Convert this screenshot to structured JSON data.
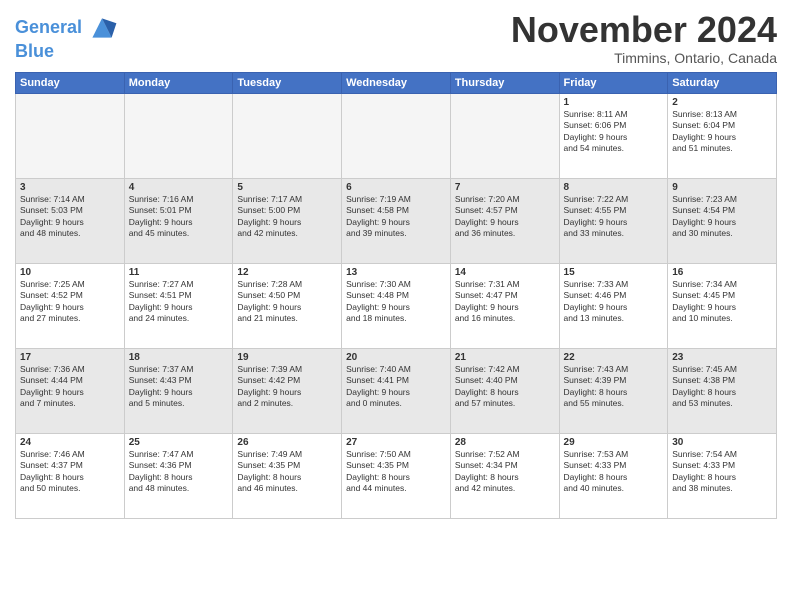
{
  "header": {
    "logo_line1": "General",
    "logo_line2": "Blue",
    "month": "November 2024",
    "location": "Timmins, Ontario, Canada"
  },
  "days_of_week": [
    "Sunday",
    "Monday",
    "Tuesday",
    "Wednesday",
    "Thursday",
    "Friday",
    "Saturday"
  ],
  "weeks": [
    [
      {
        "day": "",
        "info": "",
        "empty": true
      },
      {
        "day": "",
        "info": "",
        "empty": true
      },
      {
        "day": "",
        "info": "",
        "empty": true
      },
      {
        "day": "",
        "info": "",
        "empty": true
      },
      {
        "day": "",
        "info": "",
        "empty": true
      },
      {
        "day": "1",
        "info": "Sunrise: 8:11 AM\nSunset: 6:06 PM\nDaylight: 9 hours\nand 54 minutes."
      },
      {
        "day": "2",
        "info": "Sunrise: 8:13 AM\nSunset: 6:04 PM\nDaylight: 9 hours\nand 51 minutes."
      }
    ],
    [
      {
        "day": "3",
        "info": "Sunrise: 7:14 AM\nSunset: 5:03 PM\nDaylight: 9 hours\nand 48 minutes.",
        "shaded": true
      },
      {
        "day": "4",
        "info": "Sunrise: 7:16 AM\nSunset: 5:01 PM\nDaylight: 9 hours\nand 45 minutes.",
        "shaded": true
      },
      {
        "day": "5",
        "info": "Sunrise: 7:17 AM\nSunset: 5:00 PM\nDaylight: 9 hours\nand 42 minutes.",
        "shaded": true
      },
      {
        "day": "6",
        "info": "Sunrise: 7:19 AM\nSunset: 4:58 PM\nDaylight: 9 hours\nand 39 minutes.",
        "shaded": true
      },
      {
        "day": "7",
        "info": "Sunrise: 7:20 AM\nSunset: 4:57 PM\nDaylight: 9 hours\nand 36 minutes.",
        "shaded": true
      },
      {
        "day": "8",
        "info": "Sunrise: 7:22 AM\nSunset: 4:55 PM\nDaylight: 9 hours\nand 33 minutes.",
        "shaded": true
      },
      {
        "day": "9",
        "info": "Sunrise: 7:23 AM\nSunset: 4:54 PM\nDaylight: 9 hours\nand 30 minutes.",
        "shaded": true
      }
    ],
    [
      {
        "day": "10",
        "info": "Sunrise: 7:25 AM\nSunset: 4:52 PM\nDaylight: 9 hours\nand 27 minutes."
      },
      {
        "day": "11",
        "info": "Sunrise: 7:27 AM\nSunset: 4:51 PM\nDaylight: 9 hours\nand 24 minutes."
      },
      {
        "day": "12",
        "info": "Sunrise: 7:28 AM\nSunset: 4:50 PM\nDaylight: 9 hours\nand 21 minutes."
      },
      {
        "day": "13",
        "info": "Sunrise: 7:30 AM\nSunset: 4:48 PM\nDaylight: 9 hours\nand 18 minutes."
      },
      {
        "day": "14",
        "info": "Sunrise: 7:31 AM\nSunset: 4:47 PM\nDaylight: 9 hours\nand 16 minutes."
      },
      {
        "day": "15",
        "info": "Sunrise: 7:33 AM\nSunset: 4:46 PM\nDaylight: 9 hours\nand 13 minutes."
      },
      {
        "day": "16",
        "info": "Sunrise: 7:34 AM\nSunset: 4:45 PM\nDaylight: 9 hours\nand 10 minutes."
      }
    ],
    [
      {
        "day": "17",
        "info": "Sunrise: 7:36 AM\nSunset: 4:44 PM\nDaylight: 9 hours\nand 7 minutes.",
        "shaded": true
      },
      {
        "day": "18",
        "info": "Sunrise: 7:37 AM\nSunset: 4:43 PM\nDaylight: 9 hours\nand 5 minutes.",
        "shaded": true
      },
      {
        "day": "19",
        "info": "Sunrise: 7:39 AM\nSunset: 4:42 PM\nDaylight: 9 hours\nand 2 minutes.",
        "shaded": true
      },
      {
        "day": "20",
        "info": "Sunrise: 7:40 AM\nSunset: 4:41 PM\nDaylight: 9 hours\nand 0 minutes.",
        "shaded": true
      },
      {
        "day": "21",
        "info": "Sunrise: 7:42 AM\nSunset: 4:40 PM\nDaylight: 8 hours\nand 57 minutes.",
        "shaded": true
      },
      {
        "day": "22",
        "info": "Sunrise: 7:43 AM\nSunset: 4:39 PM\nDaylight: 8 hours\nand 55 minutes.",
        "shaded": true
      },
      {
        "day": "23",
        "info": "Sunrise: 7:45 AM\nSunset: 4:38 PM\nDaylight: 8 hours\nand 53 minutes.",
        "shaded": true
      }
    ],
    [
      {
        "day": "24",
        "info": "Sunrise: 7:46 AM\nSunset: 4:37 PM\nDaylight: 8 hours\nand 50 minutes."
      },
      {
        "day": "25",
        "info": "Sunrise: 7:47 AM\nSunset: 4:36 PM\nDaylight: 8 hours\nand 48 minutes."
      },
      {
        "day": "26",
        "info": "Sunrise: 7:49 AM\nSunset: 4:35 PM\nDaylight: 8 hours\nand 46 minutes."
      },
      {
        "day": "27",
        "info": "Sunrise: 7:50 AM\nSunset: 4:35 PM\nDaylight: 8 hours\nand 44 minutes."
      },
      {
        "day": "28",
        "info": "Sunrise: 7:52 AM\nSunset: 4:34 PM\nDaylight: 8 hours\nand 42 minutes."
      },
      {
        "day": "29",
        "info": "Sunrise: 7:53 AM\nSunset: 4:33 PM\nDaylight: 8 hours\nand 40 minutes."
      },
      {
        "day": "30",
        "info": "Sunrise: 7:54 AM\nSunset: 4:33 PM\nDaylight: 8 hours\nand 38 minutes."
      }
    ]
  ]
}
